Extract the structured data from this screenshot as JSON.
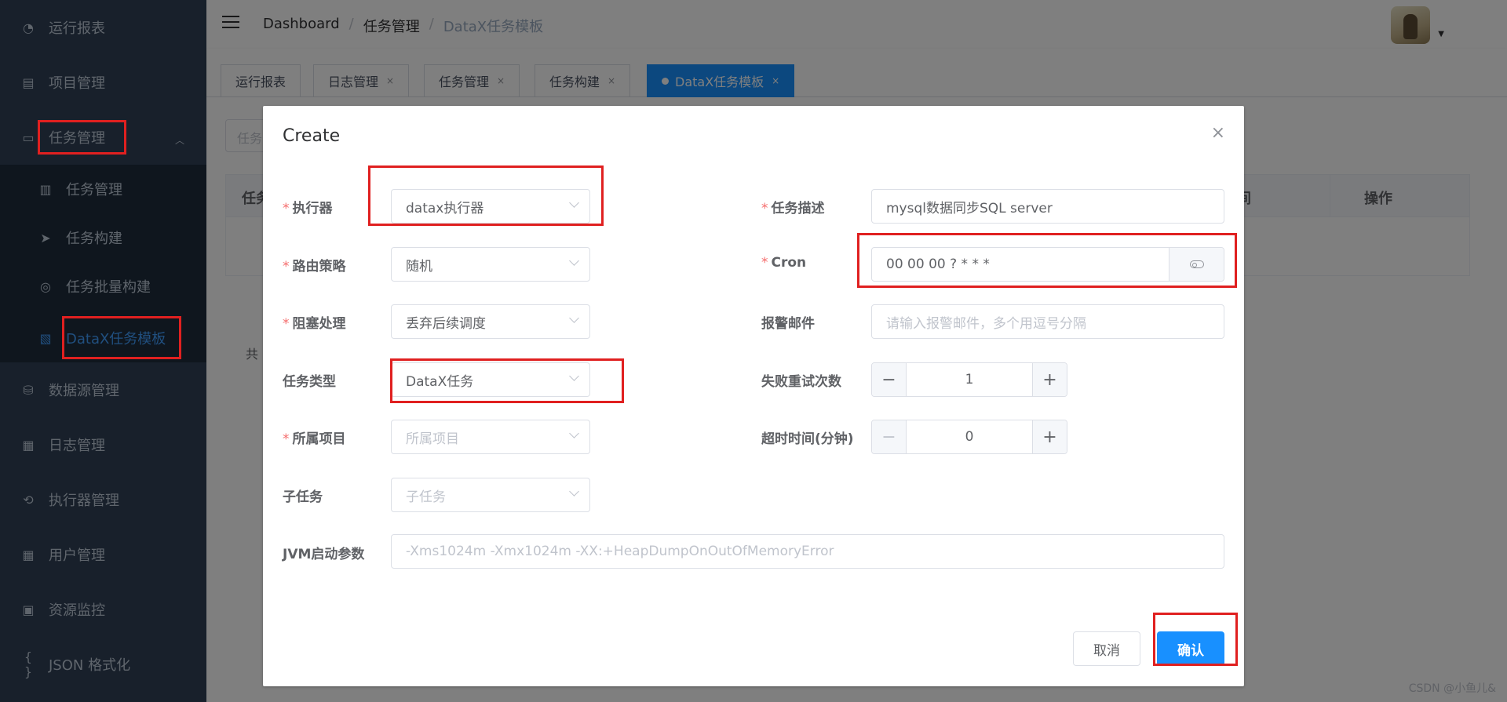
{
  "sidebar": {
    "items": [
      {
        "label": "运行报表",
        "icon": "dashboard-icon",
        "glyph": "◔"
      },
      {
        "label": "项目管理",
        "icon": "project-icon",
        "glyph": "▤"
      },
      {
        "label": "任务管理",
        "icon": "monitor-icon",
        "glyph": "▭"
      },
      {
        "label": "数据源管理",
        "icon": "database-icon",
        "glyph": "⛁"
      },
      {
        "label": "日志管理",
        "icon": "log-icon",
        "glyph": "▦"
      },
      {
        "label": "执行器管理",
        "icon": "executor-icon",
        "glyph": "⟲"
      },
      {
        "label": "用户管理",
        "icon": "user-table-icon",
        "glyph": "▦"
      },
      {
        "label": "资源监控",
        "icon": "monitor-battery-icon",
        "glyph": "▣"
      },
      {
        "label": "JSON 格式化",
        "icon": "braces-icon",
        "glyph": "{ }"
      }
    ],
    "submenu": [
      {
        "label": "任务管理",
        "icon": "calendar-icon",
        "glyph": "▥"
      },
      {
        "label": "任务构建",
        "icon": "send-icon",
        "glyph": "➤"
      },
      {
        "label": "任务批量构建",
        "icon": "gauge-icon",
        "glyph": "◎"
      },
      {
        "label": "DataX任务模板",
        "icon": "clipboard-icon",
        "glyph": "▧"
      }
    ]
  },
  "header": {
    "breadcrumb": [
      "Dashboard",
      "任务管理",
      "DataX任务模板"
    ],
    "separator": "/"
  },
  "tags": [
    {
      "label": "运行报表",
      "close": ""
    },
    {
      "label": "日志管理",
      "close": "×"
    },
    {
      "label": "任务管理",
      "close": "×"
    },
    {
      "label": "任务构建",
      "close": "×"
    },
    {
      "label": "DataX任务模板",
      "close": "×"
    }
  ],
  "background": {
    "search_placeholder": "任务",
    "col_first": "任务",
    "col_time": "时间",
    "col_action": "操作",
    "total": "共"
  },
  "dialog": {
    "title": "Create",
    "close": "×",
    "fields": {
      "executor": {
        "label": "执行器",
        "value": "datax执行器",
        "required": "*"
      },
      "route": {
        "label": "路由策略",
        "value": "随机",
        "required": "*"
      },
      "block": {
        "label": "阻塞处理",
        "value": "丢弃后续调度",
        "required": "*"
      },
      "type": {
        "label": "任务类型",
        "value": "DataX任务"
      },
      "project": {
        "label": "所属项目",
        "placeholder": "所属项目",
        "required": "*"
      },
      "child": {
        "label": "子任务",
        "placeholder": "子任务"
      },
      "jvm": {
        "label": "JVM启动参数",
        "placeholder": "-Xms1024m -Xmx1024m -XX:+HeapDumpOnOutOfMemoryError"
      },
      "desc": {
        "label": "任务描述",
        "value": "mysql数据同步SQL server",
        "required": "*"
      },
      "cron": {
        "label": "Cron",
        "value": "00 00 00 ? * * *",
        "required": "*"
      },
      "email": {
        "label": "报警邮件",
        "placeholder": "请输入报警邮件，多个用逗号分隔"
      },
      "retry": {
        "label": "失败重试次数",
        "value": "1"
      },
      "timeout": {
        "label": "超时时间(分钟)",
        "value": "0"
      }
    },
    "stepper": {
      "minus": "−",
      "plus": "+"
    },
    "cancel": "取消",
    "confirm": "确认"
  },
  "watermark": "CSDN @小鱼儿&",
  "colors": {
    "sidebar": "#304156",
    "accent": "#1890ff",
    "highlight": "#e02020"
  }
}
